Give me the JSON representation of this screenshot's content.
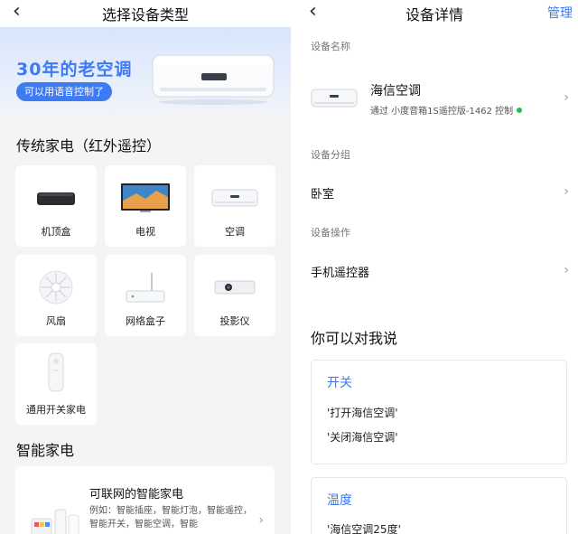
{
  "left": {
    "header": {
      "back_icon": "chevron-left-icon",
      "title": "选择设备类型"
    },
    "banner": {
      "title": "30年的老空调",
      "pill": "可以用语音控制了",
      "image": "air-conditioner-icon"
    },
    "section_ir": "传统家电（红外遥控）",
    "devices": [
      {
        "label": "机顶盒",
        "icon": "set-top-box-icon"
      },
      {
        "label": "电视",
        "icon": "tv-icon"
      },
      {
        "label": "空调",
        "icon": "air-conditioner-icon"
      },
      {
        "label": "风扇",
        "icon": "fan-icon"
      },
      {
        "label": "网络盒子",
        "icon": "network-box-icon"
      },
      {
        "label": "投影仪",
        "icon": "projector-icon"
      },
      {
        "label": "通用开关家电",
        "icon": "remote-switch-icon"
      }
    ],
    "section_smart": "智能家电",
    "smart_card": {
      "title": "可联网的智能家电",
      "desc": "例如：智能插座，智能灯泡，智能遥控，智能开关，智能空调，智能",
      "chevron": "chevron-right-icon"
    }
  },
  "right": {
    "header": {
      "back_icon": "chevron-left-icon",
      "title": "设备详情",
      "manage": "管理"
    },
    "device_name_label": "设备名称",
    "device": {
      "name": "海信空调",
      "sub": "通过 小度音箱1S遥控版-1462 控制",
      "status_color": "#2bbb4d"
    },
    "group_label": "设备分组",
    "group_value": "卧室",
    "ops_label": "设备操作",
    "ops_value": "手机遥控器",
    "say_title": "你可以对我说",
    "cards": [
      {
        "title": "开关",
        "lines": [
          "'打开海信空调'",
          "'关闭海信空调'"
        ]
      },
      {
        "title": "温度",
        "lines": [
          "'海信空调25度'"
        ]
      }
    ]
  },
  "colors": {
    "accent": "#3e7af2",
    "online": "#2bbb4d"
  }
}
